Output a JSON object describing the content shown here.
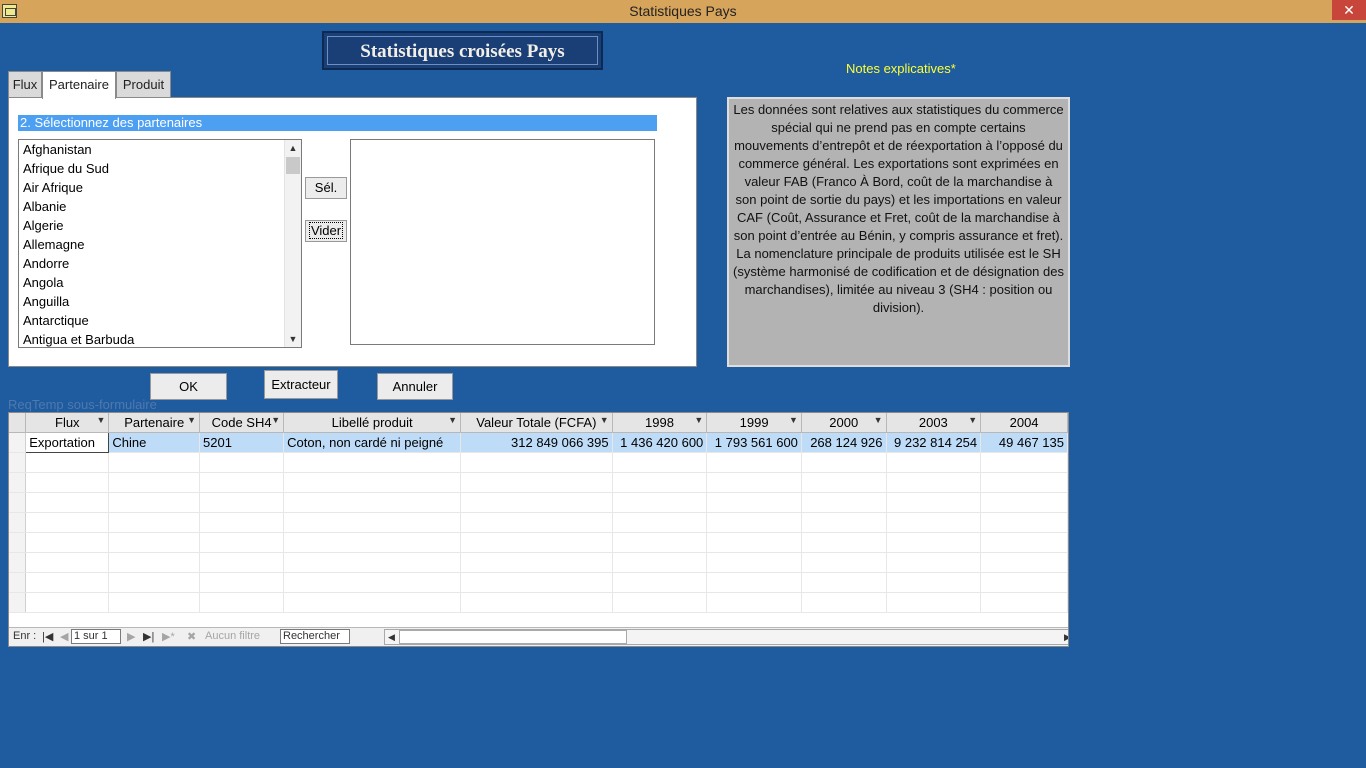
{
  "window": {
    "title": "Statistiques Pays",
    "close_label": "✕"
  },
  "heading": "Statistiques croisées Pays",
  "notes": {
    "title": "Notes explicatives*",
    "text1": "Les données sont relatives aux statistiques du commerce spécial qui ne prend pas en compte certains mouvements d’entrepôt et de réexportation à l’opposé du commerce général. Les exportations sont exprimées en valeur FAB (Franco À Bord, coût de la marchandise à son point de sortie du pays) et les importations en valeur CAF (Coût, Assurance et Fret, coût de la marchandise à son point d’entrée au Bénin, y compris assurance et fret).",
    "text2": "La nomenclature principale de produits utilisée est le SH (système harmonisé de codification et de désignation des marchandises), limitée au niveau 3 (SH4 : position ou division)."
  },
  "tabs": [
    {
      "label": "Flux"
    },
    {
      "label": "Partenaire",
      "active": true
    },
    {
      "label": "Produit"
    }
  ],
  "partner_panel": {
    "header": "2. Sélectionnez des partenaires",
    "items": [
      "Afghanistan",
      "Afrique du Sud",
      "Air Afrique",
      "Albanie",
      "Algerie",
      "Allemagne",
      "Andorre",
      "Angola",
      "Anguilla",
      "Antarctique",
      "Antigua et Barbuda"
    ],
    "select_button": "Sél.",
    "clear_button": "Vider"
  },
  "buttons": {
    "ok": "OK",
    "extract": "Extracteur",
    "cancel": "Annuler"
  },
  "subform": {
    "label": "ReqTemp sous-formulaire",
    "columns": [
      "Flux",
      "Partenaire",
      "Code SH4",
      "Libellé produit",
      "Valeur Totale (FCFA)",
      "1998",
      "1999",
      "2000",
      "2003",
      "2004"
    ],
    "rows": [
      [
        "Exportation",
        "Chine",
        "5201",
        "Coton, non cardé ni peigné",
        "312 849 066 395",
        "1 436 420 600",
        "1 793 561 600",
        "268 124 926",
        "9 232 814 254",
        "49 467 135"
      ]
    ]
  },
  "navigation": {
    "record_label": "Enr :",
    "record_value": "1 sur 1",
    "filter_label": "Aucun filtre",
    "search_label": "Rechercher"
  },
  "colors": {
    "background": "#1f5c9f",
    "titlebar": "#d7a45b",
    "notes_title": "#ffff33",
    "selection": "#4d9ff2"
  }
}
